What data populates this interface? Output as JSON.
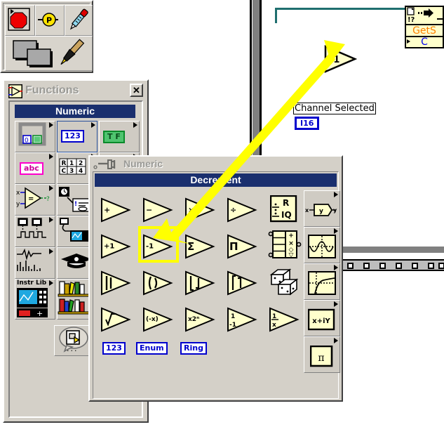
{
  "tools_palette": {
    "name": "tools-palette",
    "tools": [
      {
        "name": "operate-value-tool",
        "icon": "red-octagon-icon"
      },
      {
        "name": "probe-tool",
        "icon": "probe-P-icon"
      },
      {
        "name": "color-copy-tool",
        "icon": "eyedropper-icon"
      },
      {
        "name": "set-color-tool",
        "icon": "squares-icon"
      },
      {
        "name": "paint-brush-tool",
        "icon": "paintbrush-icon"
      }
    ]
  },
  "functions_palette": {
    "title": "Functions",
    "close_label": "✕",
    "banner": "Numeric",
    "cells": [
      {
        "name": "structures-palette",
        "label": "",
        "icon": "structures-icon",
        "has_submenu": true
      },
      {
        "name": "numeric-palette",
        "label": "123",
        "icon": "numeric-123-icon",
        "has_submenu": true,
        "selected": true
      },
      {
        "name": "boolean-palette",
        "label": "T F",
        "icon": "boolean-tf-icon",
        "has_submenu": true
      },
      {
        "name": "string-palette",
        "label": "abc",
        "icon": "string-abc-icon",
        "has_submenu": true
      },
      {
        "name": "array-cluster-palette",
        "label": "",
        "icon": "array-cluster-icon",
        "has_submenu": true
      },
      {
        "name": "comparison-palette",
        "label": "",
        "icon": "comparison-icon",
        "has_submenu": true
      },
      {
        "name": "time-dialog-palette",
        "label": "",
        "icon": "clock-dialog-icon",
        "has_submenu": true
      },
      {
        "name": "file-io-palette",
        "label": "",
        "icon": "file-io-icon",
        "has_submenu": true
      },
      {
        "name": "data-acquisition-palette",
        "label": "",
        "icon": "daq-icon",
        "has_submenu": true
      },
      {
        "name": "waveform-palette",
        "label": "",
        "icon": "waveform-icon",
        "has_submenu": true
      },
      {
        "name": "analysis-palette",
        "label": "",
        "icon": "analysis-graph-icon",
        "has_submenu": true
      },
      {
        "name": "tutorial-palette",
        "label": "",
        "icon": "graduation-cap-icon",
        "has_submenu": true
      },
      {
        "name": "instrument-library-palette",
        "label": "Instr Lib",
        "icon": "instrument-icon",
        "has_submenu": true
      },
      {
        "name": "user-libraries-palette",
        "label": "",
        "icon": "bookshelf-icon",
        "has_submenu": true
      }
    ],
    "select_vi_button": {
      "name": "select-a-vi-button",
      "label": "..."
    }
  },
  "numeric_palette": {
    "title": "Numeric",
    "banner": "Decrement",
    "pin_icon": "pushpin-icon",
    "rows": [
      [
        {
          "name": "add-function",
          "label": "+",
          "kind": "triangle"
        },
        {
          "name": "subtract-function",
          "label": "−",
          "kind": "triangle"
        },
        {
          "name": "multiply-function",
          "label": "×",
          "kind": "triangle"
        },
        {
          "name": "divide-function",
          "label": "÷",
          "kind": "triangle"
        },
        {
          "name": "quotient-remainder-function",
          "label": "R IQ",
          "kind": "box"
        }
      ],
      [
        {
          "name": "increment-function",
          "label": "+1",
          "kind": "triangle"
        },
        {
          "name": "decrement-function",
          "label": "-1",
          "kind": "triangle",
          "selected": true
        },
        {
          "name": "add-array-elements-function",
          "label": "Σ",
          "kind": "triangle"
        },
        {
          "name": "multiply-array-elements-function",
          "label": "Π",
          "kind": "triangle"
        },
        {
          "name": "compound-arithmetic-function",
          "label": "+ × ◇ ▽",
          "kind": "box"
        }
      ],
      [
        {
          "name": "absolute-value-function",
          "label": "|▶|",
          "kind": "triangle"
        },
        {
          "name": "round-to-nearest-function",
          "label": "[▶]",
          "kind": "triangle"
        },
        {
          "name": "round-toward-negative-infinity-function",
          "label": "⌊▶⌋",
          "kind": "triangle"
        },
        {
          "name": "round-toward-positive-infinity-function",
          "label": "⌈▶⌉",
          "kind": "triangle"
        },
        {
          "name": "random-number-function",
          "label": "",
          "kind": "dice"
        }
      ],
      [
        {
          "name": "square-root-function",
          "label": "√",
          "kind": "triangle"
        },
        {
          "name": "negate-function",
          "label": "(-x)",
          "kind": "triangle"
        },
        {
          "name": "scale-by-power-of-2-function",
          "label": "x2ⁿ",
          "kind": "triangle"
        },
        {
          "name": "sign-function",
          "label": "1/-1",
          "kind": "triangle"
        },
        {
          "name": "reciprocal-function",
          "label": "1/x",
          "kind": "triangle"
        }
      ]
    ],
    "constants": [
      {
        "name": "numeric-constant",
        "label": "123"
      },
      {
        "name": "enum-constant",
        "label": "Enum"
      },
      {
        "name": "ring-constant",
        "label": "Ring"
      }
    ],
    "subpalettes": [
      {
        "name": "conversion-palette",
        "label": "x ▶ y",
        "icon": "conversion-icon"
      },
      {
        "name": "trigonometric-palette",
        "label": "",
        "icon": "sine-wave-icon"
      },
      {
        "name": "logarithmic-palette",
        "label": "",
        "icon": "log-curve-icon"
      },
      {
        "name": "complex-palette",
        "label": "x + iY",
        "icon": "complex-icon"
      },
      {
        "name": "additional-numeric-constants-palette",
        "label": "π",
        "icon": "pi-icon"
      }
    ]
  },
  "block_diagram": {
    "subvi_node": {
      "name": "get-subvi-node",
      "top_icon": "document-arrow-icon",
      "label": "GetS",
      "sub_label": "C"
    },
    "decrement_node": {
      "name": "decrement-node",
      "label": "-1"
    },
    "channel_label": {
      "name": "channel-selected-label",
      "text": "Channel Selected"
    },
    "channel_terminal": {
      "name": "i16-terminal",
      "text": "I16"
    },
    "structure_tunnel_count": 7
  },
  "colors": {
    "palette_face": "#d4d0c8",
    "banner_blue": "#1a2f6e",
    "selection_yellow": "#ffff00",
    "node_yellow": "#ffffcc",
    "wire_teal": "#1f6f6f",
    "terminal_blue": "#0000cd",
    "label_orange": "#ff7f00"
  }
}
